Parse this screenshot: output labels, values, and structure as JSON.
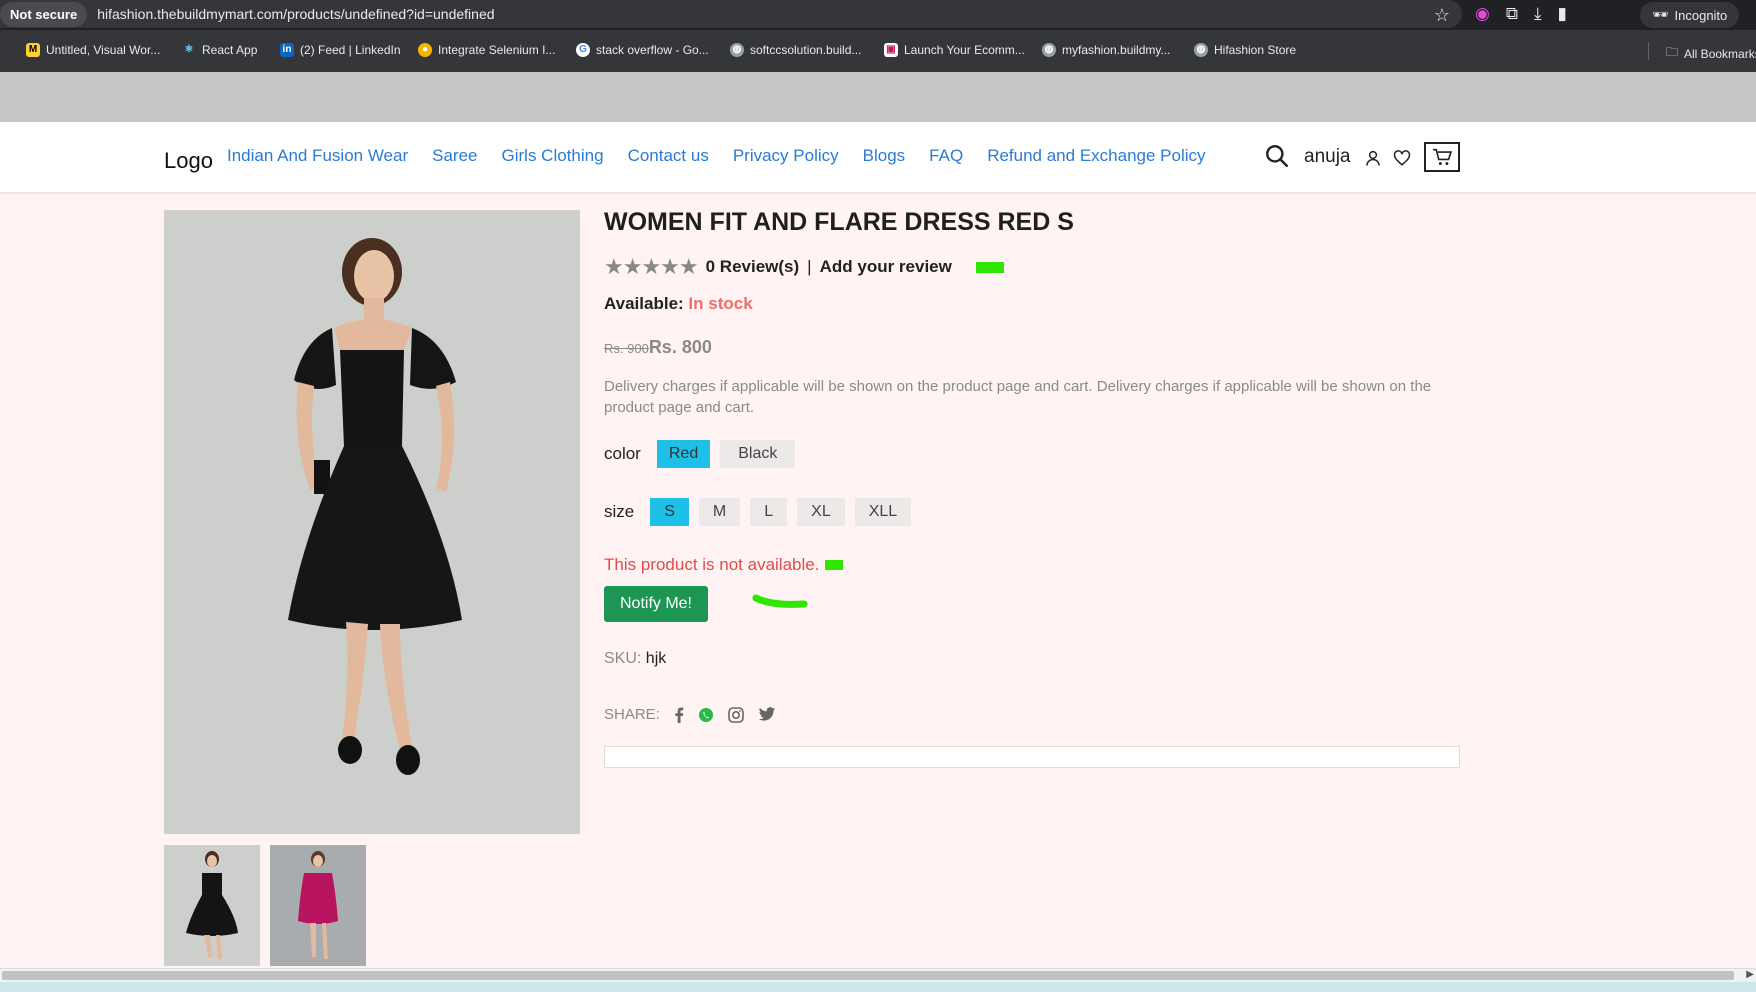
{
  "browser": {
    "security_label": "Not secure",
    "url": "hifashion.thebuildmymart.com/products/undefined?id=undefined",
    "incognito_label": "Incognito",
    "bookmarks": [
      {
        "label": "Untitled, Visual Wor...",
        "icon": "miro-icon"
      },
      {
        "label": "React App",
        "icon": "react-icon"
      },
      {
        "label": "(2) Feed | LinkedIn",
        "icon": "linkedin-icon"
      },
      {
        "label": "Integrate Selenium I...",
        "icon": "chrome-icon"
      },
      {
        "label": "stack overflow - Go...",
        "icon": "google-icon"
      },
      {
        "label": "softccsolution.build...",
        "icon": "globe-icon"
      },
      {
        "label": "Launch Your Ecomm...",
        "icon": "store-icon"
      },
      {
        "label": "myfashion.buildmy...",
        "icon": "globe-icon"
      },
      {
        "label": "Hifashion Store",
        "icon": "globe-icon"
      }
    ],
    "all_bookmarks_label": "All Bookmarks"
  },
  "header": {
    "logo": "Logo",
    "nav": [
      "Indian And Fusion Wear",
      "Saree",
      "Girls Clothing",
      "Contact us",
      "Privacy Policy",
      "Blogs",
      "FAQ",
      "Refund and Exchange Policy"
    ],
    "username": "anuja",
    "link_color": "#2a7bd6"
  },
  "product": {
    "title": "WOMEN FIT AND FLARE DRESS RED S",
    "rating_stars": 5,
    "reviews_label": "0 Review(s)",
    "separator": "|",
    "add_review_label": "Add your review",
    "available_label": "Available:",
    "stock_status": "In stock",
    "old_price": "Rs. 900",
    "new_price": "Rs. 800",
    "description": "Delivery charges if applicable will be shown on the product page and cart. Delivery charges if applicable will be shown on the product page and cart.",
    "color_label": "color",
    "colors": [
      "Red",
      "Black"
    ],
    "selected_color": "Red",
    "size_label": "size",
    "sizes": [
      "S",
      "M",
      "L",
      "XL",
      "XLL"
    ],
    "selected_size": "S",
    "unavailable_message": "This product is not available.",
    "notify_button": "Notify Me!",
    "sku_label": "SKU:",
    "sku_value": "hjk",
    "share_label": "SHARE:",
    "share_icons": [
      "facebook-icon",
      "whatsapp-icon",
      "instagram-icon",
      "twitter-icon"
    ],
    "accent_selected": "#1ec0e8",
    "notify_color": "#1d9653",
    "error_color": "#e04b4b"
  }
}
